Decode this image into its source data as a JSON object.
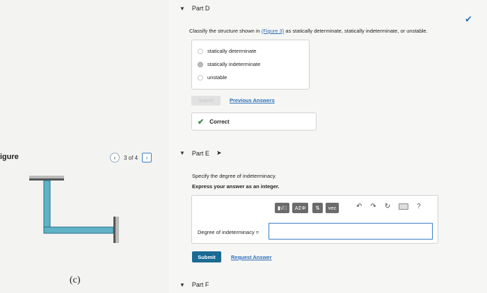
{
  "figure": {
    "title": "igure",
    "nav_prev": "‹",
    "nav_next": "›",
    "nav_count": "3 of 4",
    "caption": "(c)"
  },
  "partD": {
    "caret": "▼",
    "title": "Part D",
    "question_before": "Classify the structure shown in ",
    "figure_link": "(Figure 3)",
    "question_after": " as statically determinate, statically indeterminate, or unstable.",
    "options": [
      "statically determinate",
      "statically indeterminate",
      "unstable"
    ],
    "selected_index": 1,
    "submit_label": "Submit",
    "previous_answers_label": "Previous Answers",
    "correct_label": "Correct",
    "correct_icon": "✔",
    "status_check": "✔"
  },
  "partE": {
    "caret": "▼",
    "title": "Part E",
    "instruction": "Specify the degree of indeterminacy.",
    "instruction_bold": "Express your answer as an integer.",
    "toolbar": {
      "templates": "▮√□",
      "symbols": "ΑΣΦ",
      "arrows": "⇅",
      "vec": "vec"
    },
    "undo": "↶",
    "redo": "↷",
    "reset": "↻",
    "help": "?",
    "field_label": "Degree of indeterminacy =",
    "field_value": "",
    "submit_label": "Submit",
    "request_answer_label": "Request Answer"
  },
  "partF": {
    "caret": "▼",
    "title": "Part F"
  },
  "colors": {
    "accent": "#2b6fb6",
    "submit_bg": "#1a6a94",
    "beam": "#5fb3c7",
    "correct": "#2e8b3d"
  }
}
